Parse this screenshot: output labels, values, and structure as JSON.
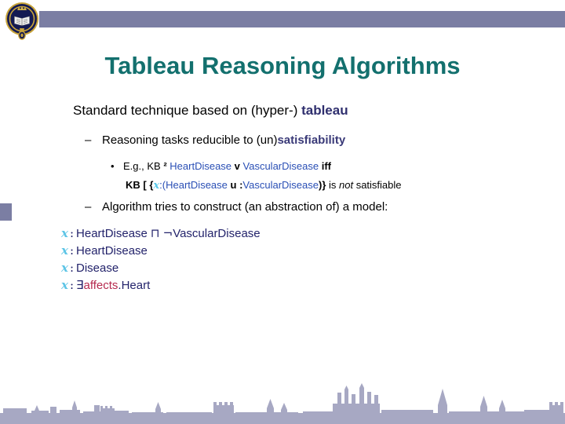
{
  "slide": {
    "title": "Tableau Reasoning Algorithms",
    "title_color": "#13706e",
    "accent_bar_color": "#7b7ea3",
    "background_color": "#ffffff"
  },
  "branding": {
    "crest_name": "oxford-university-crest",
    "skyline_name": "oxford-skyline-silhouette",
    "skyline_color": "#8a8cb0"
  },
  "content": {
    "level1": {
      "text_plain": "Standard technique based on (hyper-) ",
      "text_highlight": "tableau",
      "highlight_color": "#2f2f6e"
    },
    "level2_first": {
      "dash": "–",
      "text_plain": "Reasoning tasks reducible to (un)",
      "text_highlight": "satisfiability",
      "highlight_color": "#3a3a78"
    },
    "level3_line1": {
      "bullet": "•",
      "seg_a": "E.g., KB ",
      "entails": "²",
      "seg_b": " ",
      "class_a": "HeartDisease",
      "seg_c": " v ",
      "class_b": "VascularDisease",
      "seg_d": " iff"
    },
    "level3_line2": {
      "seg_a": "KB ",
      "bracket_open": "[",
      "brace_open": " {",
      "var": "x",
      "seg_colon": ":(",
      "class_a": "HeartDisease",
      "seg_u": " u ",
      "seg_colon2": ":",
      "class_b": "VascularDisease",
      "brace_close": ")}",
      "seg_is": " is ",
      "emph_not": "not",
      "seg_tail": " satisfiable"
    },
    "level2_second": {
      "dash": "–",
      "text": "Algorithm tries to construct (an abstraction of) a model:"
    },
    "math_lines": [
      {
        "var": "x",
        "colon": ":",
        "concept_a": "HeartDisease",
        "operator": "⊓",
        "negation": "¬",
        "concept_b": "VascularDisease"
      },
      {
        "var": "x",
        "colon": ":",
        "concept_a": "HeartDisease"
      },
      {
        "var": "x",
        "colon": ":",
        "concept_a": "Disease"
      },
      {
        "var": "x",
        "colon": ":",
        "exists": "∃",
        "role": "affects",
        "dot": ".",
        "concept_a": "Heart"
      }
    ],
    "colors": {
      "class_blue": "#2a4fb5",
      "math_navy": "#23236b",
      "var_cyan": "#5ec5e6",
      "role_crimson": "#b52a4f"
    }
  }
}
